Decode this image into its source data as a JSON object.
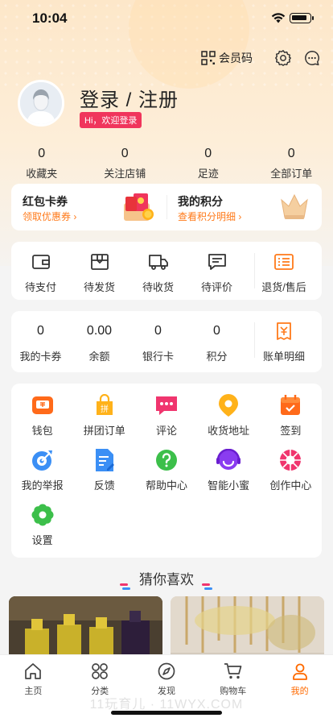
{
  "status_bar": {
    "time": "10:04"
  },
  "header": {
    "member_code_label": "会员码"
  },
  "profile": {
    "login_label": "登录 / 注册",
    "greeting": "Hi，欢迎登录"
  },
  "stats": [
    {
      "value": "0",
      "label": "收藏夹"
    },
    {
      "value": "0",
      "label": "关注店铺"
    },
    {
      "value": "0",
      "label": "足迹"
    },
    {
      "value": "0",
      "label": "全部订单"
    }
  ],
  "coupon": {
    "title": "红包卡券",
    "link": "领取优惠券 ›",
    "points_title": "我的积分",
    "points_link": "查看积分明细 ›"
  },
  "orders": [
    {
      "label": "待支付",
      "icon": "wallet-icon"
    },
    {
      "label": "待发货",
      "icon": "package-icon"
    },
    {
      "label": "待收货",
      "icon": "truck-icon"
    },
    {
      "label": "待评价",
      "icon": "comment-icon"
    },
    {
      "label": "退货/售后",
      "icon": "refund-icon"
    }
  ],
  "wallet": [
    {
      "value": "0",
      "label": "我的卡券"
    },
    {
      "value": "0.00",
      "label": "余额"
    },
    {
      "value": "0",
      "label": "银行卡"
    },
    {
      "value": "0",
      "label": "积分"
    },
    {
      "label": "账单明细",
      "icon": "bill-icon"
    }
  ],
  "tools": [
    {
      "label": "钱包",
      "icon": "wallet-icon",
      "color": "#ff6a1a"
    },
    {
      "label": "拼团订单",
      "icon": "group-order-icon",
      "color": "#ffb21a"
    },
    {
      "label": "评论",
      "icon": "comment-icon",
      "color": "#f0356e"
    },
    {
      "label": "收货地址",
      "icon": "location-icon",
      "color": "#ffb21a"
    },
    {
      "label": "签到",
      "icon": "calendar-icon",
      "color": "#ff6a1a"
    },
    {
      "label": "我的举报",
      "icon": "report-icon",
      "color": "#3b8ff5"
    },
    {
      "label": "反馈",
      "icon": "feedback-icon",
      "color": "#3b8ff5"
    },
    {
      "label": "帮助中心",
      "icon": "help-icon",
      "color": "#3cbf4a"
    },
    {
      "label": "智能小蜜",
      "icon": "assistant-icon",
      "color": "#8a3cf0"
    },
    {
      "label": "创作中心",
      "icon": "creation-icon",
      "color": "#f0356e"
    },
    {
      "label": "设置",
      "icon": "settings-icon",
      "color": "#3cbf4a"
    }
  ],
  "recommend": {
    "title": "猜你喜欢"
  },
  "tabbar": [
    {
      "label": "主页",
      "icon": "home-icon",
      "active": false
    },
    {
      "label": "分类",
      "icon": "category-icon",
      "active": false
    },
    {
      "label": "发现",
      "icon": "compass-icon",
      "active": false
    },
    {
      "label": "购物车",
      "icon": "cart-icon",
      "active": false
    },
    {
      "label": "我的",
      "icon": "user-icon",
      "active": true
    }
  ],
  "watermark": "11玩育儿 · 11WYX.COM",
  "colors": {
    "accent": "#ff6a00",
    "badge": "#f0355c",
    "order_icon": "#333333",
    "refund_icon": "#ff7a1a"
  }
}
